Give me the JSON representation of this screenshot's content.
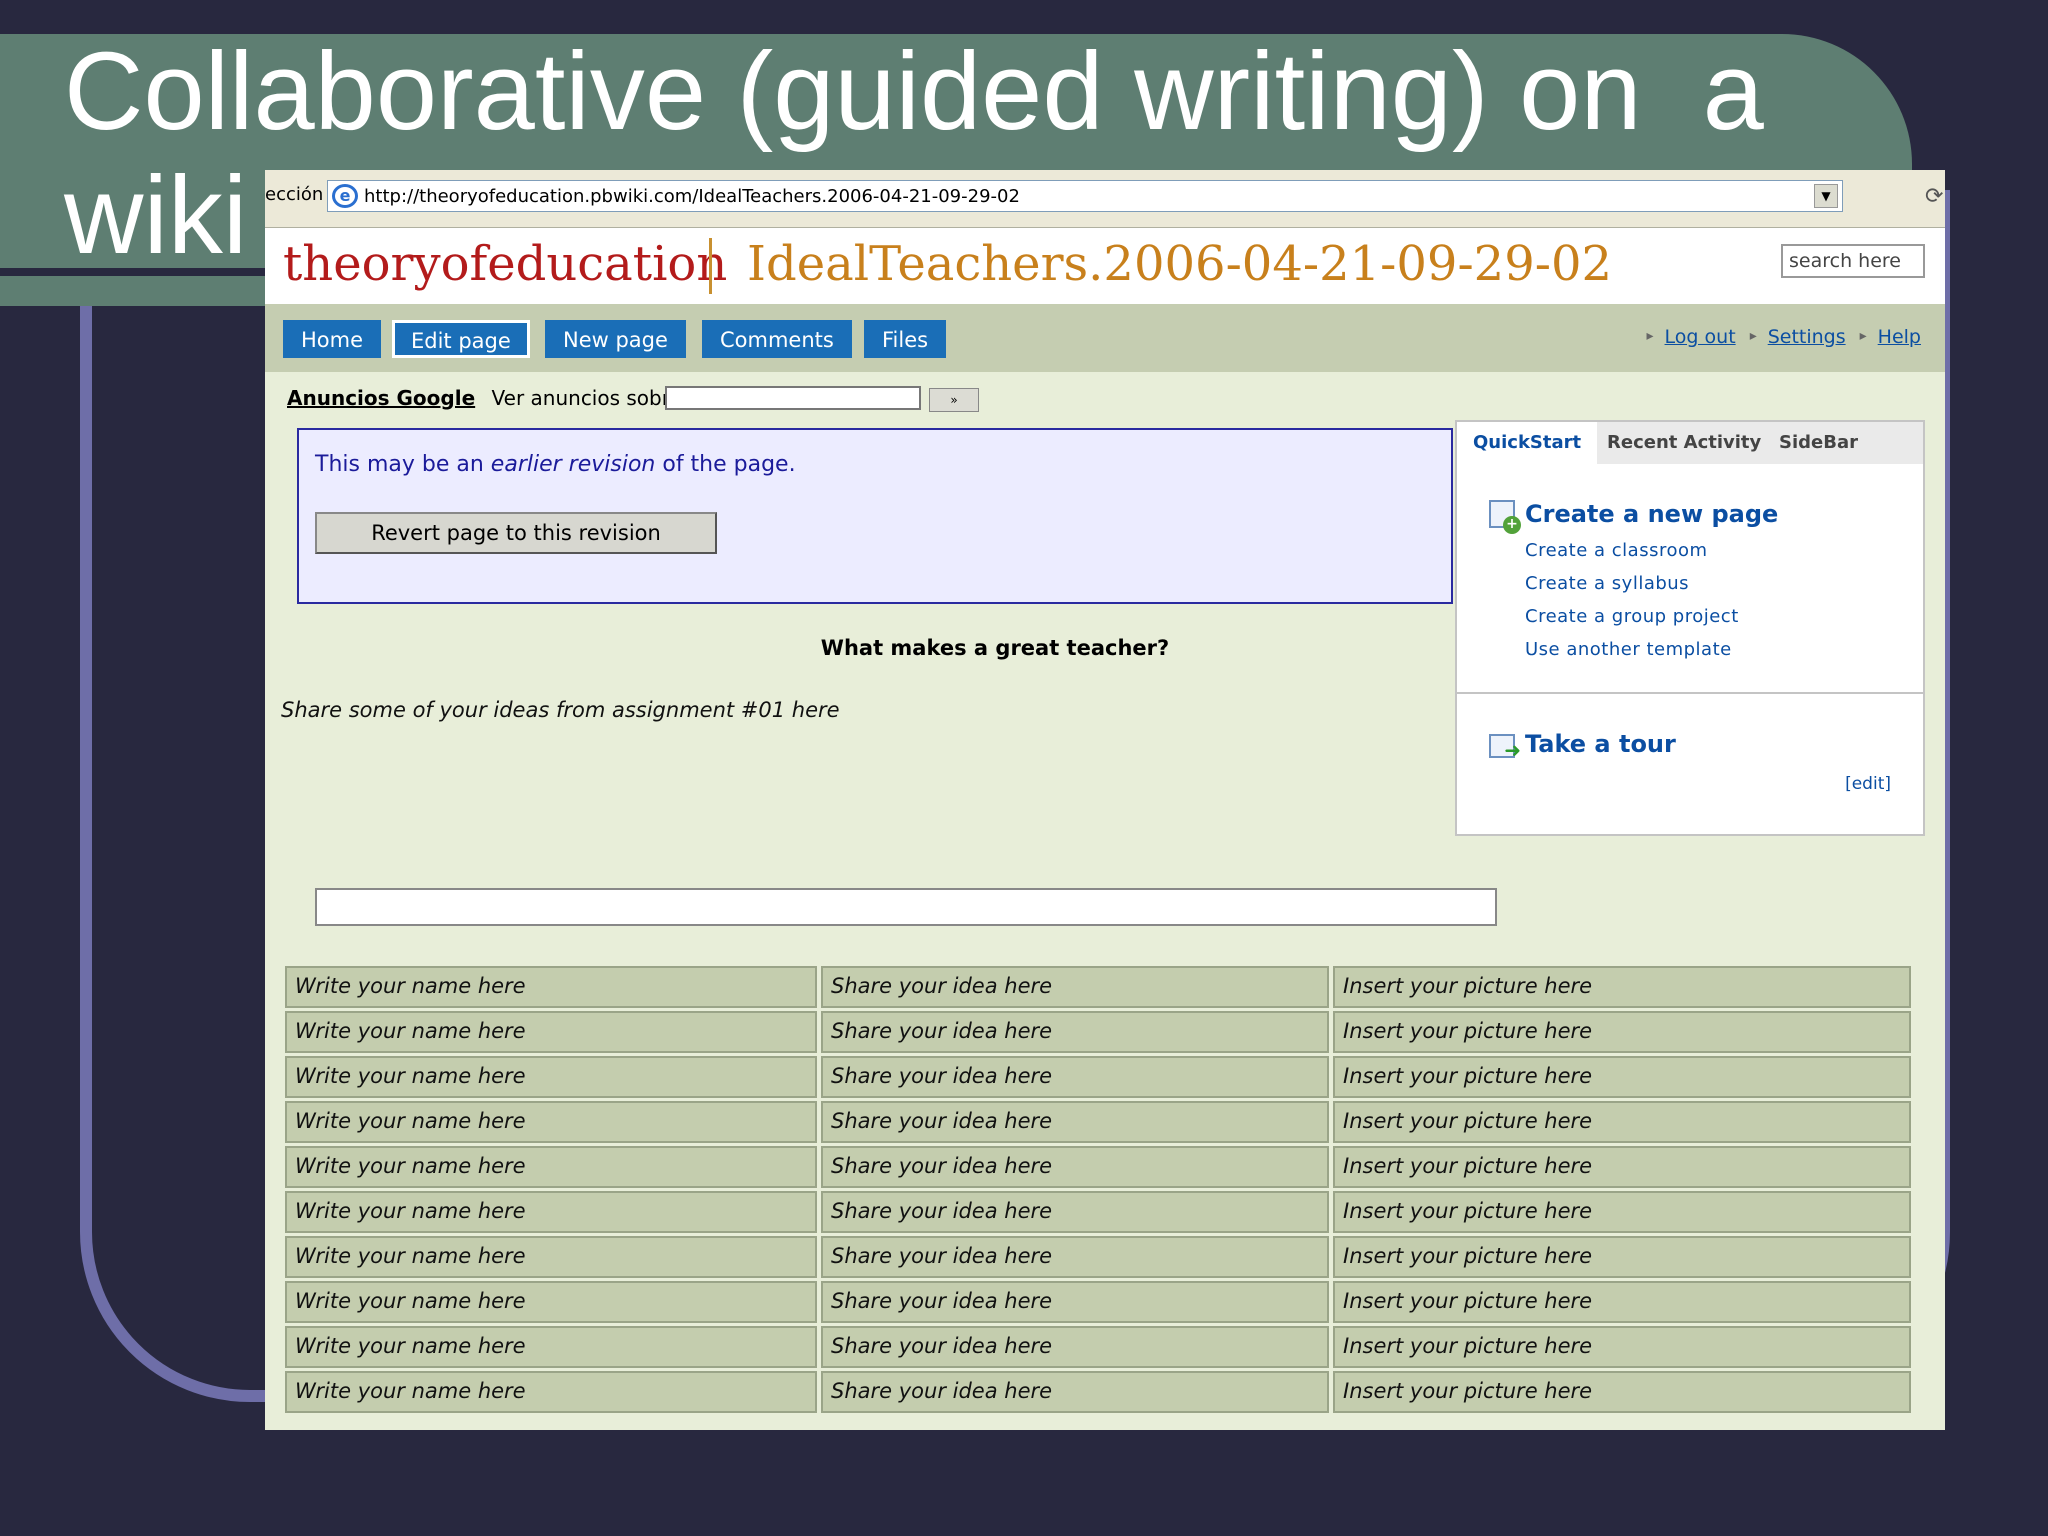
{
  "slide": {
    "title": "Collaborative (guided writing) on  a wiki"
  },
  "browser": {
    "address_label": "ección",
    "url": "http://theoryofeducation.pbwiki.com/IdealTeachers.2006-04-21-09-29-02"
  },
  "header": {
    "site_name": "theoryofeducation",
    "page_name": "IdealTeachers.2006-04-21-09-29-02",
    "search_placeholder": "search here"
  },
  "nav": {
    "buttons": [
      "Home",
      "Edit page",
      "New page",
      "Comments",
      "Files"
    ],
    "links": [
      "Log out",
      "Settings",
      "Help"
    ]
  },
  "ads": {
    "label": "Anuncios Google",
    "prompt": "Ver anuncios sobre:",
    "go": "»"
  },
  "revision": {
    "text_before": "This may be an ",
    "text_emph": "earlier revision",
    "text_after": " of the page.",
    "button": "Revert page to this revision"
  },
  "content": {
    "title": "What makes a great teacher?",
    "intro": "Share some of your ideas from assignment #01 here"
  },
  "sidebar": {
    "tabs": [
      "QuickStart",
      "Recent Activity",
      "SideBar"
    ],
    "create_heading": "Create a new page",
    "links": [
      "Create a classroom",
      "Create a syllabus",
      "Create a group project",
      "Use another template"
    ],
    "tour_heading": "Take a tour",
    "edit": "[edit]"
  },
  "table": {
    "rows": [
      [
        "Write your name here",
        "Share your idea here",
        "Insert your picture here"
      ],
      [
        "Write your name here",
        "Share your idea here",
        "Insert your picture here"
      ],
      [
        "Write your name here",
        "Share your idea here",
        "Insert your picture here"
      ],
      [
        "Write your name here",
        "Share your idea here",
        "Insert your picture here"
      ],
      [
        "Write your name here",
        "Share your idea here",
        "Insert your picture here"
      ],
      [
        "Write your name here",
        "Share your idea here",
        "Insert your picture here"
      ],
      [
        "Write your name here",
        "Share your idea here",
        "Insert your picture here"
      ],
      [
        "Write your name here",
        "Share your idea here",
        "Insert your picture here"
      ],
      [
        "Write your name here",
        "Share your idea here",
        "Insert your picture here"
      ],
      [
        "Write your name here",
        "Share your idea here",
        "Insert your picture here"
      ]
    ]
  },
  "colors": {
    "background": "#28283f",
    "title_band": "#5e7e72",
    "outline": "#6e6ea8",
    "nav_button": "#1a6eb7",
    "site_name": "#b31b1b",
    "page_name": "#c8801c",
    "link": "#0b4ea2"
  }
}
